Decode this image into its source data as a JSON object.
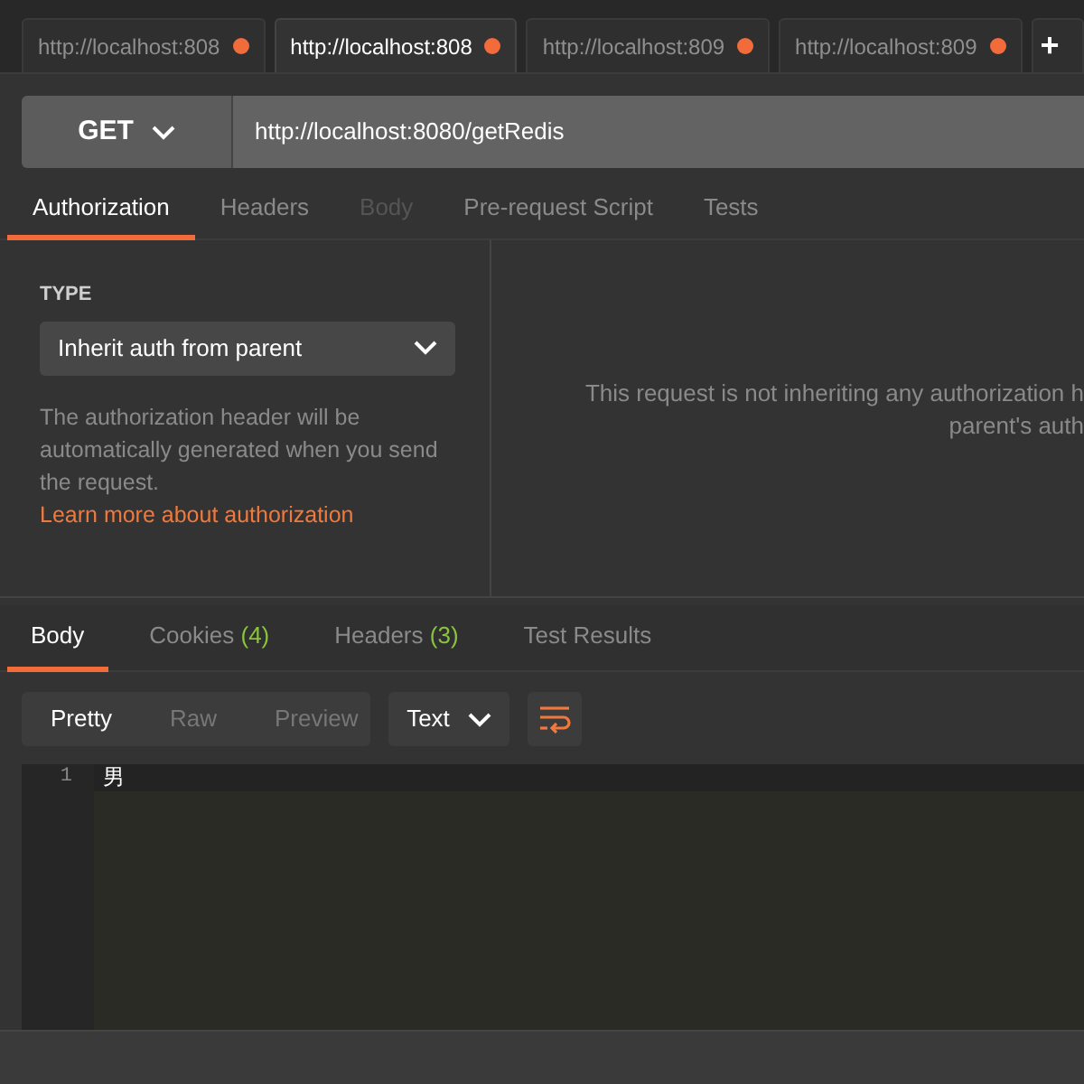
{
  "tabs": [
    {
      "label": "http://localhost:808",
      "selected": false,
      "unsaved": true
    },
    {
      "label": "http://localhost:808",
      "selected": true,
      "unsaved": true
    },
    {
      "label": "http://localhost:809",
      "selected": false,
      "unsaved": true
    },
    {
      "label": "http://localhost:809",
      "selected": false,
      "unsaved": true
    }
  ],
  "new_tab_button": "+",
  "request": {
    "method": "GET",
    "url": "http://localhost:8080/getRedis"
  },
  "request_tabs": [
    {
      "label": "Authorization",
      "selected": true,
      "disabled": false
    },
    {
      "label": "Headers",
      "selected": false,
      "disabled": false
    },
    {
      "label": "Body",
      "selected": false,
      "disabled": true
    },
    {
      "label": "Pre-request Script",
      "selected": false,
      "disabled": false
    },
    {
      "label": "Tests",
      "selected": false,
      "disabled": false
    }
  ],
  "auth": {
    "type_label": "TYPE",
    "type_value": "Inherit auth from parent",
    "description": "The authorization header will be automatically generated when you send the request.",
    "link": "Learn more about authorization",
    "notice_lines": [
      "This request is not inheriting any authorization h",
      "parent's auth"
    ]
  },
  "response_tabs": [
    {
      "label": "Body",
      "selected": true
    },
    {
      "label": "Cookies",
      "count": "(4)",
      "selected": false
    },
    {
      "label": "Headers",
      "count": "(3)",
      "selected": false
    },
    {
      "label": "Test Results",
      "selected": false
    }
  ],
  "view_modes": [
    {
      "label": "Pretty",
      "selected": true
    },
    {
      "label": "Raw",
      "selected": false
    },
    {
      "label": "Preview",
      "selected": false
    }
  ],
  "format": "Text",
  "editor": {
    "lines": [
      {
        "number": "1",
        "text": "男"
      }
    ]
  }
}
